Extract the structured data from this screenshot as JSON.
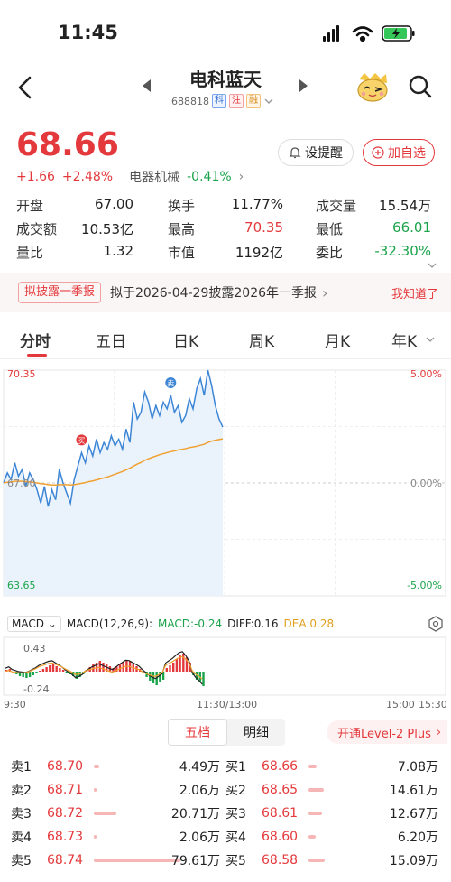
{
  "status": {
    "time": "11:45"
  },
  "header": {
    "title": "电科蓝天",
    "code": "688818",
    "tags": [
      "科",
      "注",
      "融"
    ]
  },
  "quote": {
    "price": "68.66",
    "change": "+1.66",
    "change_pct": "+2.48%",
    "sector": "电器机械",
    "sector_pct": "-0.41%",
    "remind_label": "设提醒",
    "watch_label": "加自选"
  },
  "stats": [
    [
      {
        "label": "开盘",
        "value": "67.00",
        "color": "default"
      },
      {
        "label": "换手",
        "value": "11.77%",
        "color": "default"
      },
      {
        "label": "成交量",
        "value": "15.54万",
        "color": "default"
      }
    ],
    [
      {
        "label": "成交额",
        "value": "10.53亿",
        "color": "default"
      },
      {
        "label": "最高",
        "value": "70.35",
        "color": "red"
      },
      {
        "label": "最低",
        "value": "66.01",
        "color": "green"
      }
    ],
    [
      {
        "label": "量比",
        "value": "1.32",
        "color": "default"
      },
      {
        "label": "市值",
        "value": "1192亿",
        "color": "default"
      },
      {
        "label": "委比",
        "value": "-32.30%",
        "color": "green"
      }
    ]
  ],
  "notice": {
    "tag": "拟披露一季报",
    "text": "拟于2026-04-29披露2026年一季报",
    "ack": "我知道了"
  },
  "tabs": [
    "分时",
    "五日",
    "日K",
    "周K",
    "月K",
    "年K"
  ],
  "chart_data": {
    "type": "line",
    "title": "",
    "ylim": [
      63.65,
      70.35
    ],
    "y_labels_left": [
      "70.35",
      "67.00",
      "63.65"
    ],
    "y_labels_right": [
      "5.00%",
      "0.00%",
      "-5.00%"
    ],
    "series": [
      {
        "name": "",
        "values": [
          67.0,
          67.3,
          67.1,
          67.6,
          67.2,
          67.4,
          66.9,
          67.3,
          67.1,
          66.8,
          66.4,
          66.9,
          66.3,
          66.8,
          66.5,
          67.4,
          67.0,
          66.7,
          66.4,
          67.1,
          67.5,
          67.9,
          67.6,
          68.1,
          67.8,
          68.3,
          67.9,
          68.2,
          68.0,
          68.4,
          68.1,
          68.3,
          68.0,
          68.6,
          68.2,
          69.4,
          68.9,
          69.1,
          69.7,
          69.4,
          68.9,
          69.3,
          69.0,
          69.4,
          69.2,
          69.6,
          69.1,
          69.3,
          68.8,
          69.0,
          69.5,
          69.2,
          69.8,
          70.1,
          69.6,
          70.35,
          69.9,
          69.3,
          68.9,
          68.66
        ]
      },
      {
        "name": "",
        "values": [
          67.0,
          67.02,
          67.03,
          67.05,
          67.05,
          67.05,
          67.04,
          67.03,
          67.02,
          67.0,
          66.98,
          66.97,
          66.95,
          66.94,
          66.94,
          66.95,
          66.95,
          66.95,
          66.94,
          66.95,
          66.97,
          66.99,
          67.01,
          67.04,
          67.06,
          67.09,
          67.12,
          67.15,
          67.18,
          67.22,
          67.26,
          67.3,
          67.34,
          67.39,
          67.44,
          67.5,
          67.56,
          67.61,
          67.67,
          67.72,
          67.76,
          67.8,
          67.84,
          67.87,
          67.9,
          67.93,
          67.95,
          67.98,
          68.0,
          68.02,
          68.05,
          68.07,
          68.09,
          68.12,
          68.15,
          68.2,
          68.24,
          68.27,
          68.29,
          68.31
        ]
      }
    ],
    "markers": [
      {
        "label": "买",
        "index": 21
      },
      {
        "label": "卖",
        "index": 45
      }
    ]
  },
  "macd": {
    "label": "MACD",
    "params": "MACD(12,26,9):",
    "macd": "MACD:-0.24",
    "diff": "DIFF:0.16",
    "dea": "DEA:0.28",
    "top": "0.43",
    "bottom": "-0.24"
  },
  "time_axis": [
    "9:30",
    "11:30/13:00",
    "15:00",
    "15:30"
  ],
  "orderbook": {
    "tabs": [
      "五档",
      "明细"
    ],
    "level2": "开通Level-2 Plus",
    "rows": [
      {
        "sell_label": "卖1",
        "sell_price": "68.70",
        "sell_vol": "4.49万",
        "sell_bar": 0.06,
        "buy_label": "买1",
        "buy_price": "68.66",
        "buy_vol": "7.08万",
        "buy_bar": 0.09
      },
      {
        "sell_label": "卖2",
        "sell_price": "68.71",
        "sell_vol": "2.06万",
        "sell_bar": 0.03,
        "buy_label": "买2",
        "buy_price": "68.65",
        "buy_vol": "14.61万",
        "buy_bar": 0.18
      },
      {
        "sell_label": "卖3",
        "sell_price": "68.72",
        "sell_vol": "20.71万",
        "sell_bar": 0.26,
        "buy_label": "买3",
        "buy_price": "68.61",
        "buy_vol": "12.67万",
        "buy_bar": 0.16
      },
      {
        "sell_label": "卖4",
        "sell_price": "68.73",
        "sell_vol": "2.06万",
        "sell_bar": 0.03,
        "buy_label": "买4",
        "buy_price": "68.60",
        "buy_vol": "6.20万",
        "buy_bar": 0.08
      },
      {
        "sell_label": "卖5",
        "sell_price": "68.74",
        "sell_vol": "79.61万",
        "sell_bar": 1.0,
        "buy_label": "买5",
        "buy_price": "68.58",
        "buy_vol": "15.09万",
        "buy_bar": 0.19
      }
    ]
  }
}
